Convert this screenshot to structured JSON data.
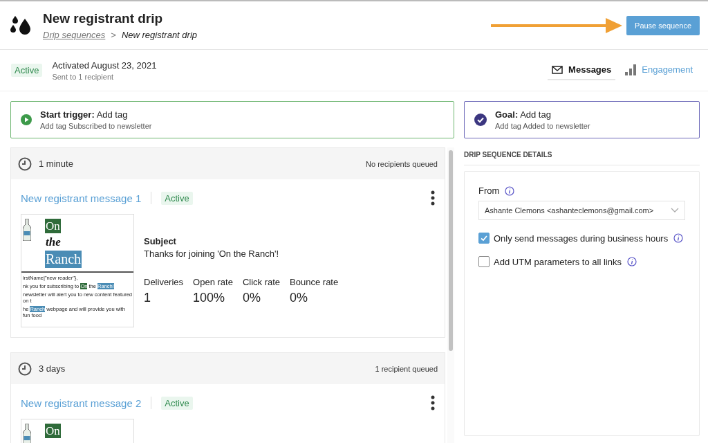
{
  "header": {
    "title": "New registrant drip",
    "breadcrumb": {
      "link": "Drip sequences",
      "separator": ">",
      "current": "New registrant drip"
    },
    "pause_button": "Pause sequence"
  },
  "status": {
    "badge": "Active",
    "activated": "Activated August 23, 2021",
    "sent": "Sent to 1 recipient"
  },
  "tabs": [
    {
      "label": "Messages",
      "kind": "messages",
      "selected": true
    },
    {
      "label": "Engagement",
      "kind": "engagement",
      "selected": false
    }
  ],
  "trigger": {
    "title_bold": "Start trigger:",
    "title": "Add tag",
    "detail": "Add tag Subscribed to newsletter"
  },
  "goal": {
    "title_bold": "Goal:",
    "title": "Add tag",
    "detail": "Add tag Added to newsletter"
  },
  "steps": [
    {
      "delay": "1 minute",
      "queued": "No recipients queued",
      "message": {
        "name": "New registrant message 1",
        "status": "Active",
        "thumbnail": {
          "logo": [
            "On",
            "the",
            "Ranch"
          ],
          "lines": [
            [
              {
                "text": "irstName|\"new reader\"},"
              }
            ],
            [
              {
                "text": "nk you for subscribing to "
              },
              {
                "text": "On",
                "color": "#2f6b3a"
              },
              {
                "text": " the "
              },
              {
                "text": "Ranch!",
                "color": "#4a8cb5"
              }
            ],
            [
              {
                "text": "newsletter will alert you to new content featured on t"
              }
            ],
            [
              {
                "text": "he "
              },
              {
                "text": "Ranch",
                "color": "#4a8cb5"
              },
              {
                "text": " webpage and will provide you with fun food"
              }
            ]
          ]
        },
        "subject_label": "Subject",
        "subject": "Thanks for joining 'On the Ranch'!",
        "stats": [
          {
            "label": "Deliveries",
            "value": "1"
          },
          {
            "label": "Open rate",
            "value": "100%"
          },
          {
            "label": "Click rate",
            "value": "0%"
          },
          {
            "label": "Bounce rate",
            "value": "0%"
          }
        ]
      }
    },
    {
      "delay": "3 days",
      "queued": "1 recipient queued",
      "message": {
        "name": "New registrant message 2",
        "status": "Active",
        "thumbnail": {
          "logo": [
            "On"
          ]
        }
      }
    }
  ],
  "details": {
    "heading": "DRIP SEQUENCE DETAILS",
    "from_label": "From",
    "from_value": "Ashante Clemons <ashanteclemons@gmail.com>",
    "options": [
      {
        "label": "Only send messages during business hours",
        "checked": true
      },
      {
        "label": "Add UTM parameters to all links",
        "checked": false
      }
    ]
  }
}
